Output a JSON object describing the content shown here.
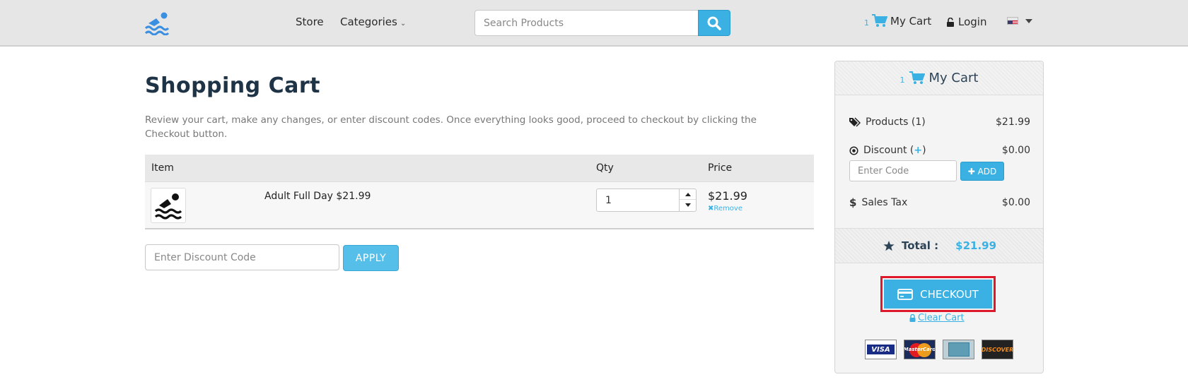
{
  "header": {
    "nav": {
      "store": "Store",
      "categories": "Categories"
    },
    "search": {
      "placeholder": "Search Products"
    },
    "cart": {
      "count": "1",
      "label": "My Cart"
    },
    "login": "Login"
  },
  "main": {
    "title": "Shopping Cart",
    "intro": "Review your cart, make any changes, or enter discount codes. Once everything looks good, proceed to checkout by clicking the Checkout button.",
    "table": {
      "headers": {
        "item": "Item",
        "qty": "Qty",
        "price": "Price"
      },
      "rows": [
        {
          "name": "Adult Full Day $21.99",
          "qty": "1",
          "price": "$21.99",
          "remove": "Remove"
        }
      ]
    },
    "discount": {
      "placeholder": "Enter Discount Code",
      "button": "APPLY"
    }
  },
  "sidebar": {
    "count": "1",
    "title": "My Cart",
    "products": {
      "label": "Products (1)",
      "value": "$21.99"
    },
    "discount": {
      "label": "Discount (",
      "plus": "+",
      "label_end": ")",
      "value": "$0.00",
      "placeholder": "Enter Code",
      "add": "ADD"
    },
    "sales_tax": {
      "label": "Sales Tax",
      "value": "$0.00"
    },
    "total": {
      "label": "Total :",
      "value": "$21.99"
    },
    "checkout": "CHECKOUT",
    "clear_cart": "Clear Cart",
    "cards": [
      "VISA",
      "MasterCard",
      "",
      "DISCOVER"
    ]
  },
  "colors": {
    "accent": "#3bb1e3",
    "highlight": "#e0182b",
    "title": "#1e3446"
  }
}
